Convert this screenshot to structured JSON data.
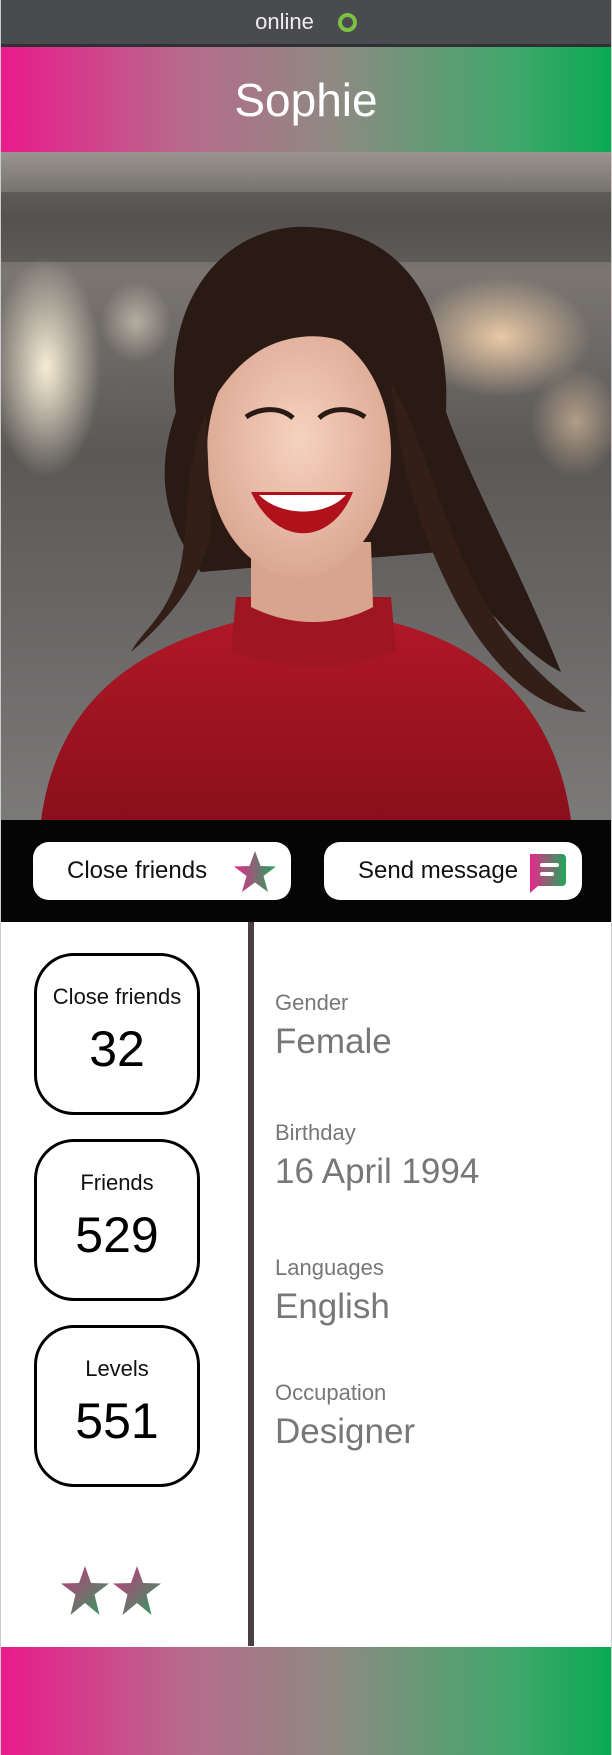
{
  "status": {
    "text": "online",
    "indicator_color": "#7cc242"
  },
  "profile": {
    "name": "Sophie"
  },
  "photo": {
    "icon": "profile-photo"
  },
  "actions": {
    "close_friends_label": "Close friends",
    "close_friends_icon": "star-icon",
    "send_message_label": "Send message",
    "send_message_icon": "chat-bubble-icon"
  },
  "stats": [
    {
      "label": "Close friends",
      "value": "32"
    },
    {
      "label": "Friends",
      "value": "529"
    },
    {
      "label": "Levels",
      "value": "551"
    }
  ],
  "rating": {
    "stars": 2,
    "icon": "star-icon"
  },
  "info": [
    {
      "label": "Gender",
      "value": "Female"
    },
    {
      "label": "Birthday",
      "value": "16 April 1994"
    },
    {
      "label": "Languages",
      "value": "English"
    },
    {
      "label": "Occupation",
      "value": "Designer"
    }
  ],
  "colors": {
    "gradient_start": "#ea1a8c",
    "gradient_end": "#0aa953",
    "status_bar": "#4a4b4f",
    "action_bar": "#050505",
    "info_text": "#777777"
  }
}
